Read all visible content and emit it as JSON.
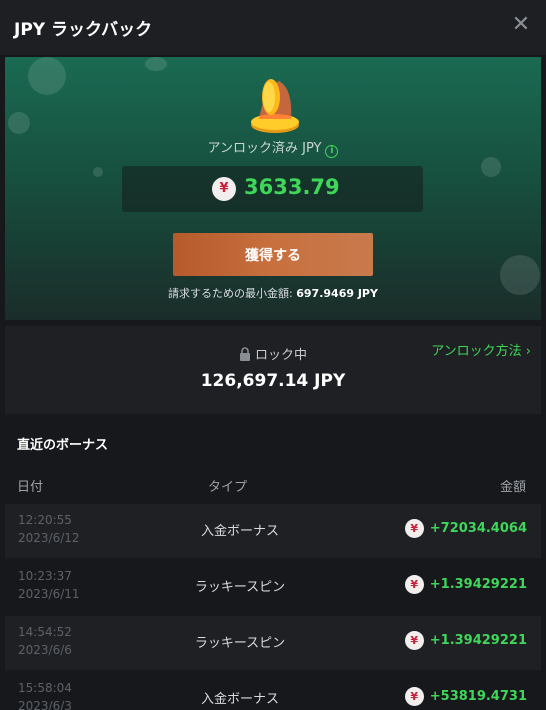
{
  "header": {
    "title": "JPY ラックバック",
    "close_icon": "close-icon"
  },
  "hero": {
    "unlocked_label": "アンロック済み JPY",
    "info_icon": "info-icon",
    "currency_symbol": "¥",
    "unlocked_amount": "3633.79",
    "claim_label": "獲得する",
    "min_claim_prefix": "請求するための最小金額:",
    "min_claim_value": "697.9469 JPY"
  },
  "locked": {
    "label": "ロック中",
    "amount": "126,697.14 JPY",
    "how_link": "アンロック方法 ›"
  },
  "recent": {
    "title": "直近のボーナス",
    "columns": {
      "date": "日付",
      "type": "タイプ",
      "amount": "金額"
    },
    "rows": [
      {
        "time": "12:20:55",
        "date": "2023/6/12",
        "type": "入金ボーナス",
        "amount": "+72034.4064"
      },
      {
        "time": "10:23:37",
        "date": "2023/6/11",
        "type": "ラッキースピン",
        "amount": "+1.39429221"
      },
      {
        "time": "14:54:52",
        "date": "2023/6/6",
        "type": "ラッキースピン",
        "amount": "+1.39429221"
      },
      {
        "time": "15:58:04",
        "date": "2023/6/3",
        "type": "入金ボーナス",
        "amount": "+53819.4731"
      }
    ]
  },
  "colors": {
    "accent_green": "#3fd65a",
    "claim_orange": "#c8703e",
    "hero_green": "#1a6a52"
  }
}
